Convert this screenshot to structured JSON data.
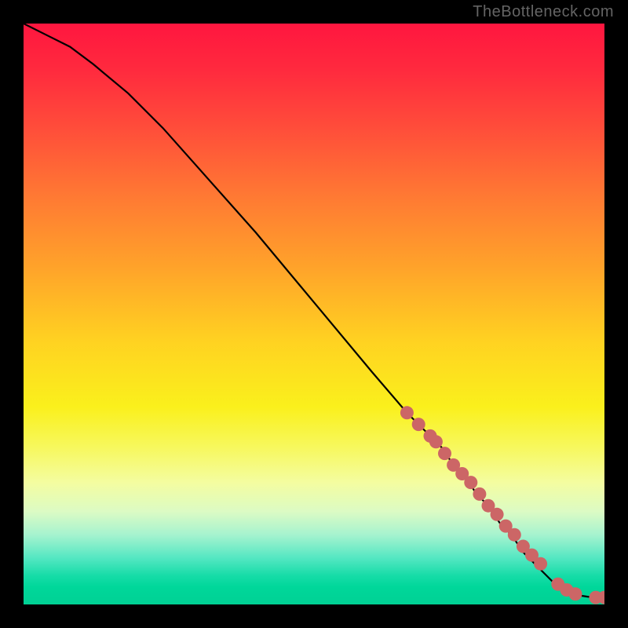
{
  "watermark": "TheBottleneck.com",
  "chart_data": {
    "type": "line",
    "title": "",
    "xlabel": "",
    "ylabel": "",
    "xlim": [
      0,
      100
    ],
    "ylim": [
      0,
      100
    ],
    "series": [
      {
        "name": "curve",
        "x": [
          0,
          4,
          8,
          12,
          18,
          24,
          32,
          40,
          50,
          60,
          66,
          68,
          70,
          72,
          74,
          76,
          78,
          80,
          82,
          84,
          86,
          88,
          90,
          92,
          94,
          96,
          98,
          100
        ],
        "values": [
          100,
          98,
          96,
          93,
          88,
          82,
          73,
          64,
          52,
          40,
          33,
          31,
          29,
          27,
          24,
          22,
          19,
          17,
          14,
          12,
          9,
          7,
          5,
          3,
          2,
          1.5,
          1.2,
          1.2
        ]
      }
    ],
    "highlight_points": {
      "name": "pink-markers",
      "color": "#cc6666",
      "x": [
        66,
        68,
        70,
        71,
        72.5,
        74,
        75.5,
        77,
        78.5,
        80,
        81.5,
        83,
        84.5,
        86,
        87.5,
        89,
        92,
        93.5,
        95,
        98.5,
        100
      ],
      "values": [
        33,
        31,
        29,
        28,
        26,
        24,
        22.5,
        21,
        19,
        17,
        15.5,
        13.5,
        12,
        10,
        8.5,
        7,
        3.5,
        2.5,
        1.8,
        1.2,
        1.2
      ]
    }
  }
}
